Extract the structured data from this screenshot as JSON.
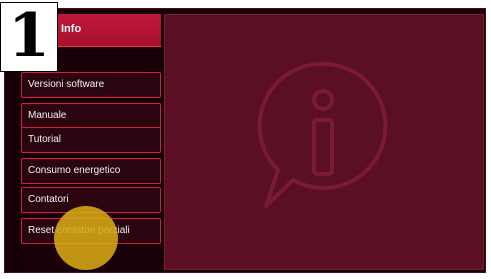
{
  "step": {
    "number": "1"
  },
  "header": {
    "title": "Info"
  },
  "menu": {
    "items": [
      {
        "label": "Versioni software"
      },
      {
        "label": "Manuale"
      },
      {
        "label": "Tutorial"
      },
      {
        "label": "Consumo energetico"
      },
      {
        "label": "Contatori"
      },
      {
        "label": "Reset contatori parziali"
      }
    ]
  },
  "content": {
    "icon": "info-speech-bubble-icon"
  },
  "colors": {
    "accent": "#c0183a",
    "background": "#150008",
    "panel": "#5a0f22",
    "tap_indicator": "#d6aa14"
  }
}
